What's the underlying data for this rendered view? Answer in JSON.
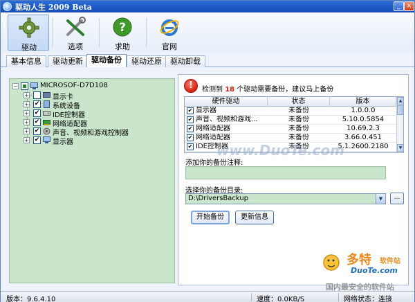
{
  "window": {
    "title": "驱动人生 2009 Beta"
  },
  "toolbar": {
    "items": [
      {
        "label": "驱动",
        "icon": "gear-icon"
      },
      {
        "label": "选项",
        "icon": "tools-icon"
      },
      {
        "label": "求助",
        "icon": "help-icon"
      },
      {
        "label": "官网",
        "icon": "ie-icon"
      }
    ]
  },
  "tabs": [
    {
      "label": "基本信息"
    },
    {
      "label": "驱动更新"
    },
    {
      "label": "驱动备份"
    },
    {
      "label": "驱动还原"
    },
    {
      "label": "驱动卸载"
    }
  ],
  "tree": {
    "root": "MICROSOF-D7D108",
    "items": [
      {
        "label": "显示卡",
        "checked": false
      },
      {
        "label": "系统设备",
        "checked": true
      },
      {
        "label": "IDE控制器",
        "checked": true
      },
      {
        "label": "网络适配器",
        "checked": true
      },
      {
        "label": "声音、视频和游戏控制器",
        "checked": true
      },
      {
        "label": "显示器",
        "checked": true
      }
    ]
  },
  "notice": {
    "prefix": "检测到",
    "count": "18",
    "suffix": "个驱动需要备份，建议马上备份"
  },
  "grid": {
    "headers": [
      "硬件驱动",
      "状态",
      "版本"
    ],
    "rows": [
      {
        "name": "显示器",
        "status": "未备份",
        "version": "1.0.0.0"
      },
      {
        "name": "声音、视频和游戏...",
        "status": "未备份",
        "version": "5.10.0.5854"
      },
      {
        "name": "网络适配器",
        "status": "未备份",
        "version": "10.69.2.3"
      },
      {
        "name": "网络适配器",
        "status": "未备份",
        "version": "3.66.0.451"
      },
      {
        "name": "IDE控制器",
        "status": "未备份",
        "version": "5.1.2600.2180"
      }
    ]
  },
  "form": {
    "note_label": "添加你的备份注释:",
    "note_value": "",
    "dir_label": "选择你的备份目录:",
    "dir_value": "D:\\DriversBackup",
    "browse_label": "...",
    "start_label": "开始备份",
    "refresh_label": "更新信息"
  },
  "status": {
    "version": "版本：9.6.4.10",
    "speed": "速度：0.0KB/S",
    "network": "网络状态：连接"
  },
  "watermark": {
    "main": "www.DuoTe.com",
    "brand": "多特",
    "brand2": "软件站",
    "url": "DuoTe.com",
    "slogan": "国内最安全的软件站"
  }
}
